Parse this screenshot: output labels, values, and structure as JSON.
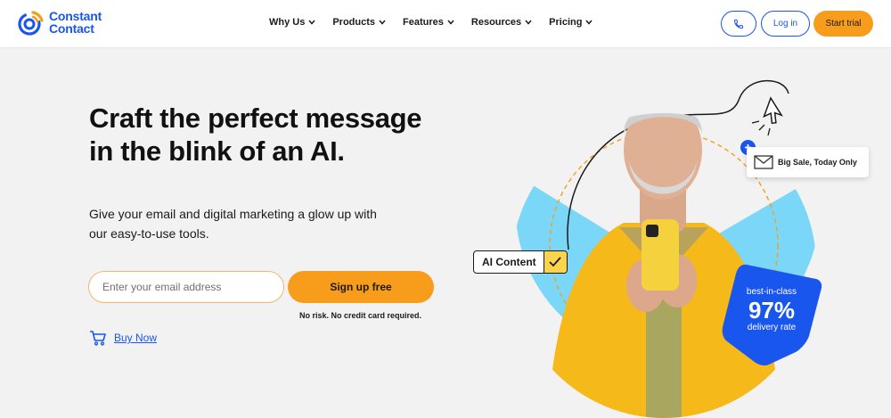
{
  "brand": {
    "line1": "Constant",
    "line2": "Contact",
    "color": "#1856ed",
    "accent": "#f89c1c"
  },
  "nav": {
    "items": [
      {
        "label": "Why Us"
      },
      {
        "label": "Products"
      },
      {
        "label": "Features"
      },
      {
        "label": "Resources"
      },
      {
        "label": "Pricing"
      }
    ],
    "phone_icon": "phone-icon",
    "login_label": "Log in",
    "trial_label": "Start trial"
  },
  "hero": {
    "title": "Craft the perfect message in the blink of an AI.",
    "subtitle": "Give your email and digital marketing a glow up with our easy-to-use tools.",
    "email_placeholder": "Enter your email address",
    "signup_label": "Sign up free",
    "disclaimer": "No risk. No credit card required.",
    "buy_now_label": "Buy Now"
  },
  "illustration": {
    "ai_chip_label": "AI Content",
    "sale_label": "Big Sale, Today Only",
    "badge_top": "best-in-class",
    "badge_value": "97%",
    "badge_bottom": "delivery rate"
  }
}
